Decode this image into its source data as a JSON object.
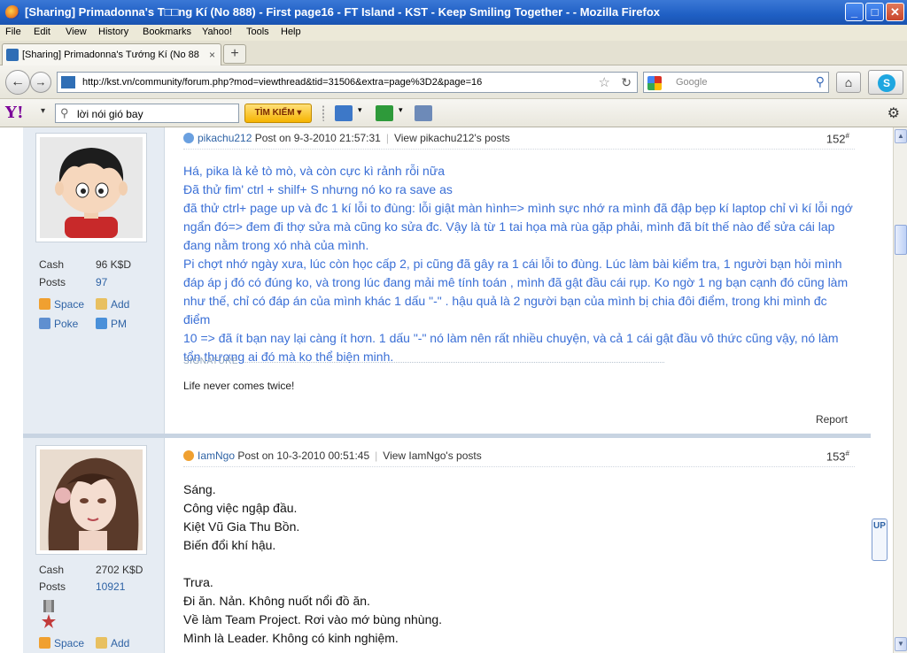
{
  "window": {
    "title": "[Sharing] Primadonna's T□□ng Kí (No 888) - First page16 - FT Island - KST - Keep Smiling Together - - Mozilla Firefox",
    "minimize": "_",
    "maximize": "□",
    "close": "✕"
  },
  "menu": [
    "File",
    "Edit",
    "View",
    "History",
    "Bookmarks",
    "Yahoo!",
    "Tools",
    "Help"
  ],
  "tab": {
    "label": "[Sharing] Primadonna's Tướng Kí (No 888) - ...",
    "close": "×",
    "new": "+"
  },
  "nav": {
    "back": "←",
    "forward": "→",
    "url": "http://kst.vn/community/forum.php?mod=viewthread&tid=31506&extra=page%3D2&page=16",
    "search_placeholder": "Google",
    "home": "⌂",
    "skype": "S"
  },
  "yahoo": {
    "logo": "Y!",
    "search_value": "lời nói gió bay",
    "search_button": "TÌM KIẾM ▾"
  },
  "posts": [
    {
      "author": "pikachu212",
      "posted": "Post on 9-3-2010 21:57:31",
      "view_link": "View pikachu212's posts",
      "number": "152",
      "stats": {
        "cash_label": "Cash",
        "cash_value": "96 K$D",
        "posts_label": "Posts",
        "posts_value": "97"
      },
      "actions": {
        "space": "Space",
        "add": "Add",
        "poke": "Poke",
        "pm": "PM"
      },
      "lines": [
        "Há, pika là kẻ tò mò, và còn cực kì rảnh rỗi nữa",
        "Đã thử fim' ctrl + shilf+ S  nhưng nó ko ra save as",
        "đã thử ctrl+ page up và đc 1 kí lỗi to đùng: lỗi giật màn hình=> mình sực nhớ ra mình đã đập bẹp kí laptop chỉ vì kí lỗi ngớ",
        "ngẩn đó=> đem đi thợ sửa mà cũng ko sửa đc. Vậy là từ 1 tai họa mà rùa gặp phải, mình đã bít thế nào để sửa cái lap",
        "đang nằm trong xó nhà của mình.",
        "Pi chợt nhớ ngày xưa, lúc còn học cấp 2, pi cũng đã gây ra 1 cái lỗi to đùng. Lúc làm bài kiểm tra, 1 người bạn hỏi mình",
        "đáp áp j đó có đúng ko, và trong lúc đang mải mê tính toán , mình đã gật đầu cái rụp. Ko ngờ 1 ng bạn cạnh đó cũng làm",
        "như thế, chỉ có đáp án của mình khác 1 dấu \"-\" . hậu quả là 2 người bạn của mình bị chia đôi điểm, trong khi mình đc điểm",
        "10 => đã ít bạn nay lại càng ít hơn. 1 dấu \"-\" nó làm nên rất nhiều chuyện, và cả 1 cái gật đầu vô thức cũng vậy, nó làm",
        "tổn thương ai đó mà ko thể biện minh."
      ],
      "signature_label": "SIGNATURE",
      "signature": "Life never comes twice!",
      "report": "Report"
    },
    {
      "author": "IamNgo",
      "posted": "Post on 10-3-2010 00:51:45",
      "view_link": "View IamNgo's posts",
      "number": "153",
      "stats": {
        "cash_label": "Cash",
        "cash_value": "2702 K$D",
        "posts_label": "Posts",
        "posts_value": "10921"
      },
      "actions": {
        "space": "Space",
        "add": "Add"
      },
      "lines": [
        "Sáng.",
        "Công việc ngập đầu.",
        "Kiệt Vũ Gia Thu Bồn.",
        "Biến đổi khí hậu.",
        "",
        "Trưa.",
        "Đi ăn. Nản. Không nuốt nổi đồ ăn.",
        "Về làm Team Project. Rơi vào mớ bùng nhùng.",
        "Mình là Leader. Không có kinh nghiệm."
      ]
    }
  ],
  "up_button": "UP",
  "post_number_suffix": "#"
}
